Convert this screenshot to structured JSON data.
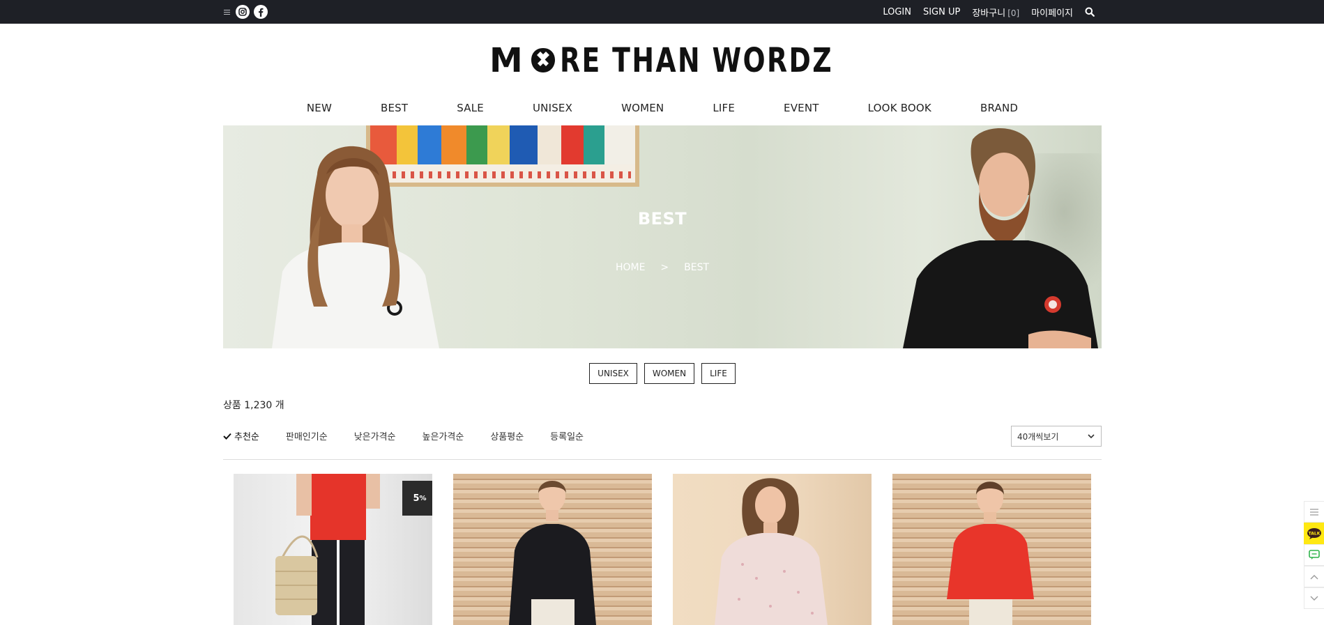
{
  "topbar": {
    "menu_icon": "hamburger-icon",
    "instagram_icon": "instagram-icon",
    "facebook_icon": "facebook-icon",
    "links": {
      "login": "LOGIN",
      "signup": "SIGN UP",
      "cart": "장바구니",
      "cart_count": "[0]",
      "mypage": "마이페이지"
    },
    "search_icon": "search-icon"
  },
  "brand": {
    "logo_text": "MORE THAN WORDZ"
  },
  "gnb": [
    "NEW",
    "BEST",
    "SALE",
    "UNISEX",
    "WOMEN",
    "LIFE",
    "EVENT",
    "LOOK BOOK",
    "BRAND"
  ],
  "banner": {
    "title": "BEST",
    "breadcrumb": {
      "home": "HOME",
      "sep": ">",
      "current": "BEST"
    }
  },
  "categories": [
    "UNISEX",
    "WOMEN",
    "LIFE"
  ],
  "product_count": {
    "label": "상품",
    "value": "1,230",
    "unit": "개"
  },
  "sort": {
    "options": [
      "추천순",
      "판매인기순",
      "낮은가격순",
      "높은가격순",
      "상품평순",
      "등록일순"
    ],
    "active": "추천순",
    "per_page": "40개씩보기"
  },
  "products": [
    {
      "badge": "5",
      "badge_unit": "%",
      "background": "wall-white"
    },
    {
      "background": "shutter"
    },
    {
      "background": "wall-beige"
    },
    {
      "background": "shutter"
    }
  ],
  "quick_menu": [
    "list-icon",
    "kakao-talk-icon",
    "chat-icon",
    "scroll-up-icon",
    "scroll-down-icon"
  ],
  "quick_menu_talk_text": "TALK",
  "colors": {
    "topbar_bg": "#1e2026",
    "text": "#222222",
    "badge_bg": "#2b2b2b",
    "talk_yellow": "#ffe812"
  }
}
